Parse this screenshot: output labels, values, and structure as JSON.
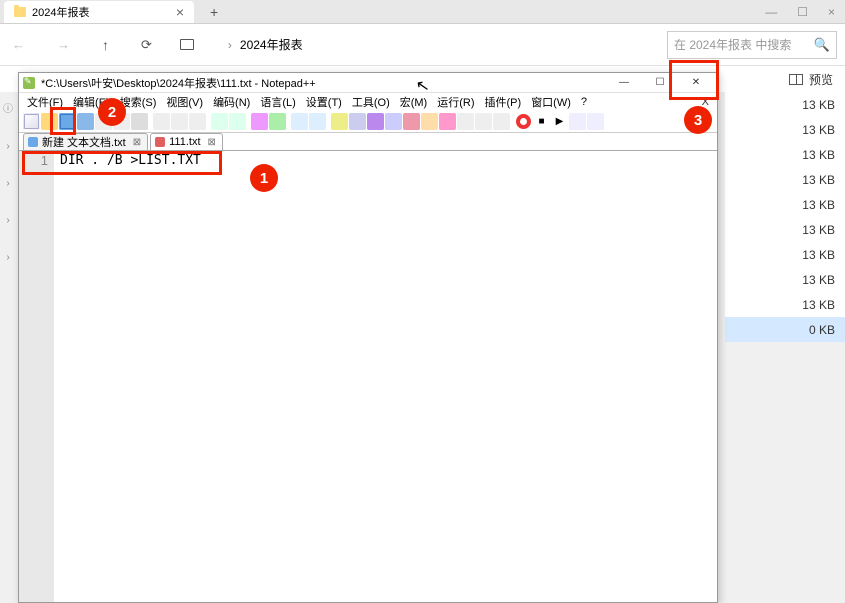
{
  "explorer": {
    "tab_title": "2024年报表",
    "breadcrumb": "2024年报表",
    "search_placeholder": "在 2024年报表 中搜索",
    "preview_label": "预览",
    "sizes": [
      "13 KB",
      "13 KB",
      "13 KB",
      "13 KB",
      "13 KB",
      "13 KB",
      "13 KB",
      "13 KB",
      "13 KB",
      "0 KB"
    ]
  },
  "npp": {
    "title": "*C:\\Users\\叶安\\Desktop\\2024年报表\\111.txt - Notepad++",
    "menu": [
      "文件(F)",
      "编辑(E)",
      "搜索(S)",
      "视图(V)",
      "编码(N)",
      "语言(L)",
      "设置(T)",
      "工具(O)",
      "宏(M)",
      "运行(R)",
      "插件(P)",
      "窗口(W)",
      "?"
    ],
    "tabs": [
      {
        "label": "新建 文本文档.txt",
        "icon": "blue",
        "active": false
      },
      {
        "label": "111.txt",
        "icon": "red",
        "active": true
      }
    ],
    "line_number": "1",
    "content": "DIR . /B >LIST.TXT"
  },
  "annotations": {
    "c1": "1",
    "c2": "2",
    "c3": "3"
  }
}
